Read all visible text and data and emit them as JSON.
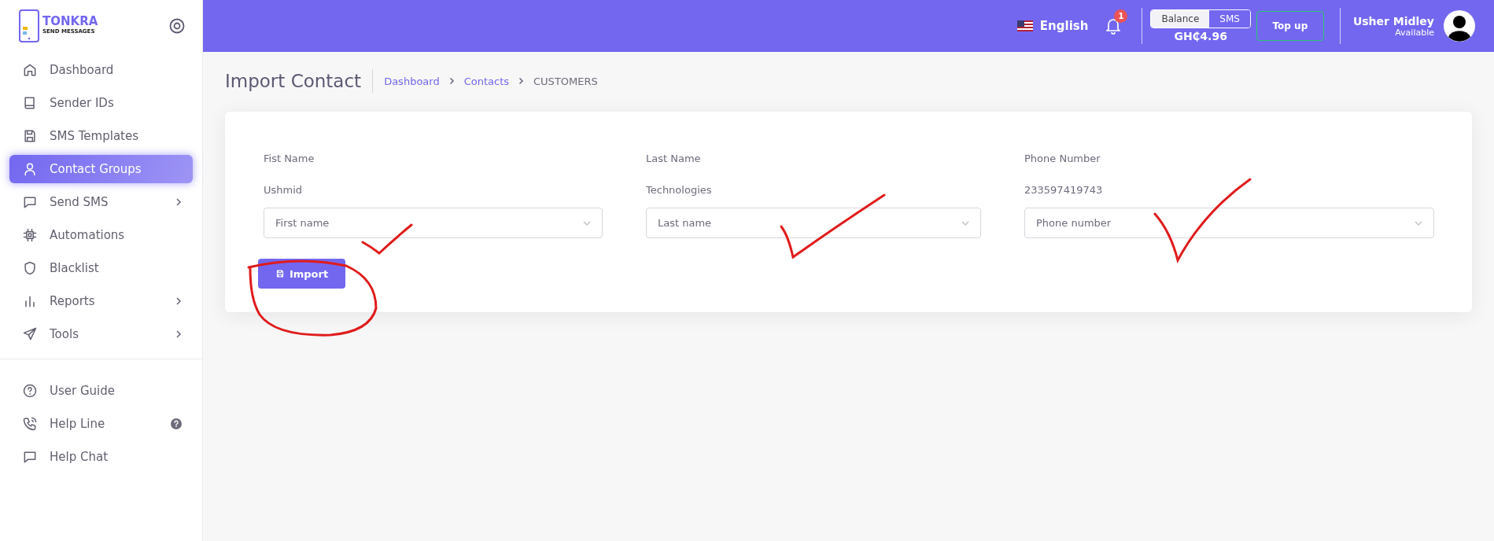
{
  "sidebar": {
    "brand": {
      "name": "TONKRA",
      "tagline": "SEND MESSAGES"
    },
    "items": [
      {
        "label": "Dashboard",
        "selected": false,
        "has_submenu": false,
        "info_badge": false
      },
      {
        "label": "Sender IDs",
        "selected": false,
        "has_submenu": false,
        "info_badge": false
      },
      {
        "label": "SMS Templates",
        "selected": false,
        "has_submenu": false,
        "info_badge": false
      },
      {
        "label": "Contact Groups",
        "selected": true,
        "has_submenu": false,
        "info_badge": false
      },
      {
        "label": "Send SMS",
        "selected": false,
        "has_submenu": true,
        "info_badge": false
      },
      {
        "label": "Automations",
        "selected": false,
        "has_submenu": false,
        "info_badge": false
      },
      {
        "label": "Blacklist",
        "selected": false,
        "has_submenu": false,
        "info_badge": false
      },
      {
        "label": "Reports",
        "selected": false,
        "has_submenu": true,
        "info_badge": false
      },
      {
        "label": "Tools",
        "selected": false,
        "has_submenu": true,
        "info_badge": false
      }
    ],
    "help_items": [
      {
        "label": "User Guide",
        "selected": false,
        "has_submenu": false,
        "info_badge": false
      },
      {
        "label": "Help Line",
        "selected": false,
        "has_submenu": false,
        "info_badge": true
      },
      {
        "label": "Help Chat",
        "selected": false,
        "has_submenu": false,
        "info_badge": false
      }
    ]
  },
  "topbar": {
    "language": "English",
    "notification_count": "1",
    "balance_tabs": [
      {
        "label": "Balance",
        "selected": true
      },
      {
        "label": "SMS",
        "selected": false
      }
    ],
    "balance": "GH₵4.96",
    "top_up": "Top up",
    "user": {
      "name": "Usher Midley",
      "status": "Available"
    }
  },
  "page": {
    "title": "Import Contact",
    "breadcrumb": [
      {
        "label": "Dashboard",
        "link": true
      },
      {
        "label": "Contacts",
        "link": true
      },
      {
        "label": "CUSTOMERS",
        "link": false
      }
    ],
    "columns": [
      {
        "label": "Fist Name",
        "value": "Ushmid",
        "placeholder": "First name"
      },
      {
        "label": "Last Name",
        "value": "Technologies",
        "placeholder": "Last name"
      },
      {
        "label": "Phone Number",
        "value": "233597419743",
        "placeholder": "Phone number"
      }
    ],
    "import_button": "Import"
  }
}
